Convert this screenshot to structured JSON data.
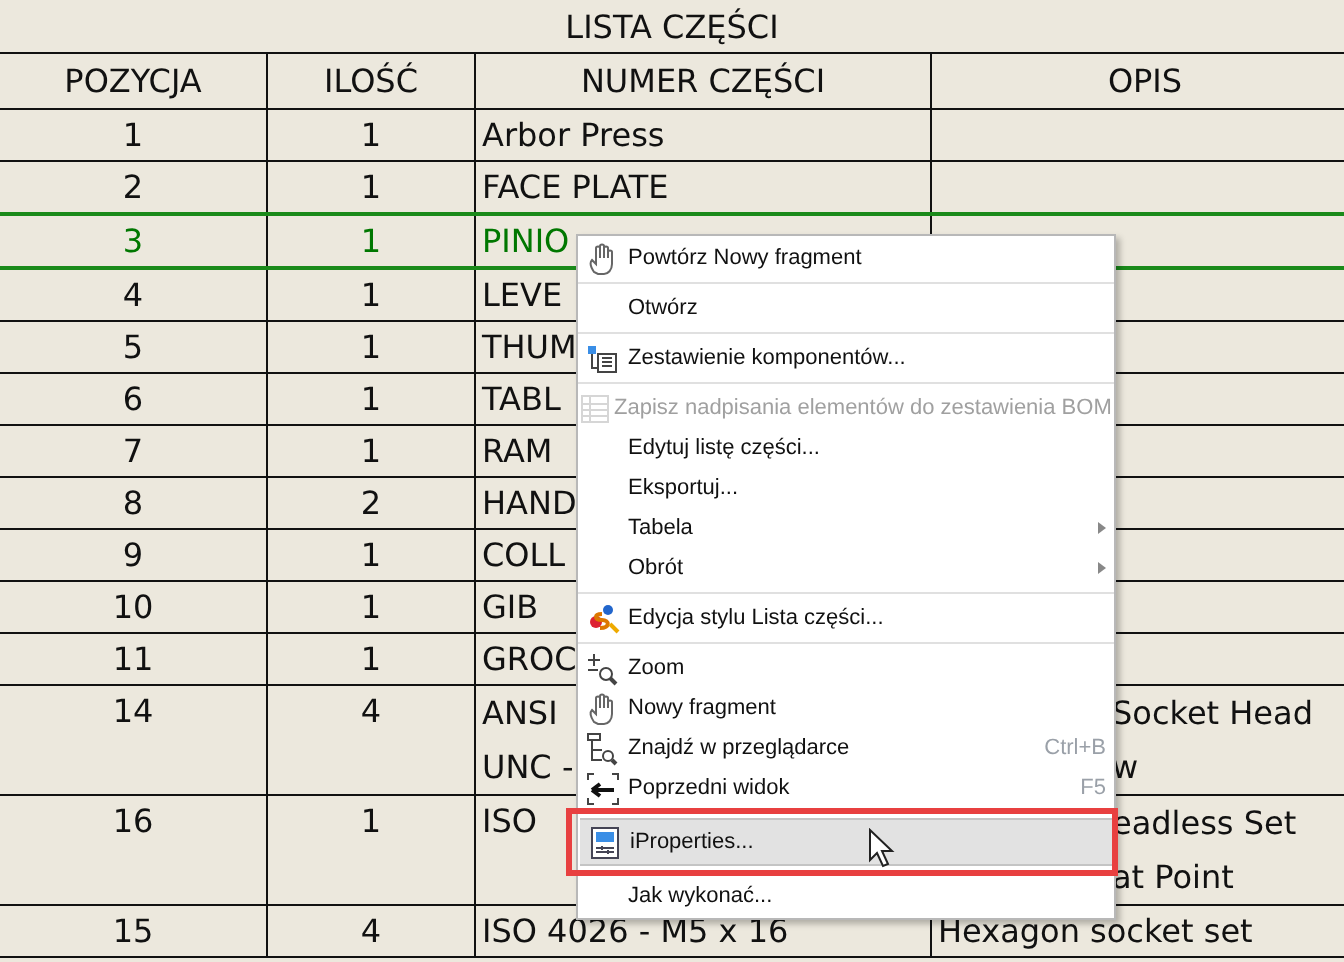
{
  "table": {
    "title": "LISTA CZĘŚCI",
    "columns": [
      "POZYCJA",
      "ILOŚĆ",
      "NUMER CZĘŚCI",
      "OPIS"
    ],
    "rows": [
      {
        "selected": false,
        "cells": [
          "1",
          "1",
          [
            "Arbor Press"
          ],
          []
        ]
      },
      {
        "selected": false,
        "cells": [
          "2",
          "1",
          [
            "FACE PLATE"
          ],
          []
        ]
      },
      {
        "selected": true,
        "cells": [
          "3",
          "1",
          [
            "PINIO"
          ],
          []
        ]
      },
      {
        "selected": false,
        "cells": [
          "4",
          "1",
          [
            "LEVE"
          ],
          []
        ]
      },
      {
        "selected": false,
        "cells": [
          "5",
          "1",
          [
            "THUM"
          ],
          []
        ]
      },
      {
        "selected": false,
        "cells": [
          "6",
          "1",
          [
            "TABL"
          ],
          []
        ]
      },
      {
        "selected": false,
        "cells": [
          "7",
          "1",
          [
            "RAM"
          ],
          []
        ]
      },
      {
        "selected": false,
        "cells": [
          "8",
          "2",
          [
            "HAND"
          ],
          []
        ]
      },
      {
        "selected": false,
        "cells": [
          "9",
          "1",
          [
            "COLL"
          ],
          []
        ]
      },
      {
        "selected": false,
        "cells": [
          "10",
          "1",
          [
            "GIB"
          ],
          []
        ]
      },
      {
        "selected": false,
        "cells": [
          "11",
          "1",
          [
            "GROC"
          ],
          []
        ]
      },
      {
        "selected": false,
        "cells": [
          "14",
          "4",
          [
            "ANSI",
            "UNC -"
          ],
          [
            "Socket Head",
            "w"
          ]
        ],
        "opis_covered": true
      },
      {
        "selected": false,
        "cells": [
          "16",
          "1",
          [
            "ISO"
          ],
          [
            "eadless Set",
            "at Point"
          ]
        ],
        "opis_covered": true
      },
      {
        "selected": false,
        "cells": [
          "15",
          "4",
          [
            "ISO 4026 - M5 x 16"
          ],
          [
            "Hexagon socket set"
          ]
        ],
        "opis_covered": false
      }
    ]
  },
  "context_menu": {
    "items": [
      {
        "kind": "hand",
        "label": "Powtórz Nowy fragment",
        "disabled": false,
        "selected": false
      },
      {
        "kind": "separator"
      },
      {
        "kind": "plain",
        "label": "Otwórz",
        "disabled": false,
        "selected": false
      },
      {
        "kind": "separator"
      },
      {
        "kind": "components",
        "label": "Zestawienie komponentów...",
        "disabled": false,
        "selected": false
      },
      {
        "kind": "separator"
      },
      {
        "kind": "table",
        "label": "Zapisz nadpisania elementów do zestawienia BOM",
        "disabled": true,
        "selected": false
      },
      {
        "kind": "plain",
        "label": "Edytuj listę części...",
        "disabled": false,
        "selected": false
      },
      {
        "kind": "plain",
        "label": "Eksportuj...",
        "disabled": false,
        "selected": false
      },
      {
        "kind": "plain",
        "label": "Tabela",
        "submenu": true,
        "disabled": false,
        "selected": false
      },
      {
        "kind": "plain",
        "label": "Obrót",
        "submenu": true,
        "disabled": false,
        "selected": false
      },
      {
        "kind": "separator"
      },
      {
        "kind": "style",
        "label": "Edycja stylu Lista części...",
        "disabled": false,
        "selected": false
      },
      {
        "kind": "separator"
      },
      {
        "kind": "zoom",
        "label": "Zoom",
        "disabled": false,
        "selected": false
      },
      {
        "kind": "hand",
        "label": "Nowy fragment",
        "disabled": false,
        "selected": false
      },
      {
        "kind": "find",
        "label": "Znajdź w przeglądarce",
        "shortcut": "Ctrl+B",
        "disabled": false,
        "selected": false
      },
      {
        "kind": "back",
        "label": "Poprzedni widok",
        "shortcut": "F5",
        "disabled": false,
        "selected": false
      },
      {
        "kind": "separator"
      },
      {
        "kind": "props",
        "label": "iProperties...",
        "disabled": false,
        "selected": true,
        "outlined": true
      },
      {
        "kind": "separator"
      },
      {
        "kind": "plain",
        "label": "Jak wykonać...",
        "disabled": false,
        "selected": false
      }
    ]
  }
}
